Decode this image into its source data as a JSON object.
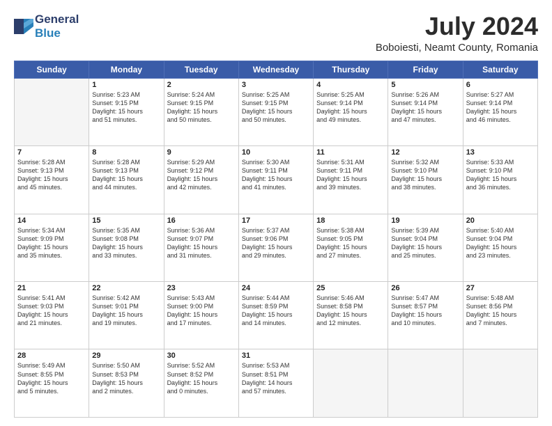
{
  "header": {
    "logo_general": "General",
    "logo_blue": "Blue",
    "month_year": "July 2024",
    "location": "Boboiesti, Neamt County, Romania"
  },
  "weekdays": [
    "Sunday",
    "Monday",
    "Tuesday",
    "Wednesday",
    "Thursday",
    "Friday",
    "Saturday"
  ],
  "weeks": [
    [
      {
        "day": "",
        "text": ""
      },
      {
        "day": "1",
        "text": "Sunrise: 5:23 AM\nSunset: 9:15 PM\nDaylight: 15 hours\nand 51 minutes."
      },
      {
        "day": "2",
        "text": "Sunrise: 5:24 AM\nSunset: 9:15 PM\nDaylight: 15 hours\nand 50 minutes."
      },
      {
        "day": "3",
        "text": "Sunrise: 5:25 AM\nSunset: 9:15 PM\nDaylight: 15 hours\nand 50 minutes."
      },
      {
        "day": "4",
        "text": "Sunrise: 5:25 AM\nSunset: 9:14 PM\nDaylight: 15 hours\nand 49 minutes."
      },
      {
        "day": "5",
        "text": "Sunrise: 5:26 AM\nSunset: 9:14 PM\nDaylight: 15 hours\nand 47 minutes."
      },
      {
        "day": "6",
        "text": "Sunrise: 5:27 AM\nSunset: 9:14 PM\nDaylight: 15 hours\nand 46 minutes."
      }
    ],
    [
      {
        "day": "7",
        "text": "Sunrise: 5:28 AM\nSunset: 9:13 PM\nDaylight: 15 hours\nand 45 minutes."
      },
      {
        "day": "8",
        "text": "Sunrise: 5:28 AM\nSunset: 9:13 PM\nDaylight: 15 hours\nand 44 minutes."
      },
      {
        "day": "9",
        "text": "Sunrise: 5:29 AM\nSunset: 9:12 PM\nDaylight: 15 hours\nand 42 minutes."
      },
      {
        "day": "10",
        "text": "Sunrise: 5:30 AM\nSunset: 9:11 PM\nDaylight: 15 hours\nand 41 minutes."
      },
      {
        "day": "11",
        "text": "Sunrise: 5:31 AM\nSunset: 9:11 PM\nDaylight: 15 hours\nand 39 minutes."
      },
      {
        "day": "12",
        "text": "Sunrise: 5:32 AM\nSunset: 9:10 PM\nDaylight: 15 hours\nand 38 minutes."
      },
      {
        "day": "13",
        "text": "Sunrise: 5:33 AM\nSunset: 9:10 PM\nDaylight: 15 hours\nand 36 minutes."
      }
    ],
    [
      {
        "day": "14",
        "text": "Sunrise: 5:34 AM\nSunset: 9:09 PM\nDaylight: 15 hours\nand 35 minutes."
      },
      {
        "day": "15",
        "text": "Sunrise: 5:35 AM\nSunset: 9:08 PM\nDaylight: 15 hours\nand 33 minutes."
      },
      {
        "day": "16",
        "text": "Sunrise: 5:36 AM\nSunset: 9:07 PM\nDaylight: 15 hours\nand 31 minutes."
      },
      {
        "day": "17",
        "text": "Sunrise: 5:37 AM\nSunset: 9:06 PM\nDaylight: 15 hours\nand 29 minutes."
      },
      {
        "day": "18",
        "text": "Sunrise: 5:38 AM\nSunset: 9:05 PM\nDaylight: 15 hours\nand 27 minutes."
      },
      {
        "day": "19",
        "text": "Sunrise: 5:39 AM\nSunset: 9:04 PM\nDaylight: 15 hours\nand 25 minutes."
      },
      {
        "day": "20",
        "text": "Sunrise: 5:40 AM\nSunset: 9:04 PM\nDaylight: 15 hours\nand 23 minutes."
      }
    ],
    [
      {
        "day": "21",
        "text": "Sunrise: 5:41 AM\nSunset: 9:03 PM\nDaylight: 15 hours\nand 21 minutes."
      },
      {
        "day": "22",
        "text": "Sunrise: 5:42 AM\nSunset: 9:01 PM\nDaylight: 15 hours\nand 19 minutes."
      },
      {
        "day": "23",
        "text": "Sunrise: 5:43 AM\nSunset: 9:00 PM\nDaylight: 15 hours\nand 17 minutes."
      },
      {
        "day": "24",
        "text": "Sunrise: 5:44 AM\nSunset: 8:59 PM\nDaylight: 15 hours\nand 14 minutes."
      },
      {
        "day": "25",
        "text": "Sunrise: 5:46 AM\nSunset: 8:58 PM\nDaylight: 15 hours\nand 12 minutes."
      },
      {
        "day": "26",
        "text": "Sunrise: 5:47 AM\nSunset: 8:57 PM\nDaylight: 15 hours\nand 10 minutes."
      },
      {
        "day": "27",
        "text": "Sunrise: 5:48 AM\nSunset: 8:56 PM\nDaylight: 15 hours\nand 7 minutes."
      }
    ],
    [
      {
        "day": "28",
        "text": "Sunrise: 5:49 AM\nSunset: 8:55 PM\nDaylight: 15 hours\nand 5 minutes."
      },
      {
        "day": "29",
        "text": "Sunrise: 5:50 AM\nSunset: 8:53 PM\nDaylight: 15 hours\nand 2 minutes."
      },
      {
        "day": "30",
        "text": "Sunrise: 5:52 AM\nSunset: 8:52 PM\nDaylight: 15 hours\nand 0 minutes."
      },
      {
        "day": "31",
        "text": "Sunrise: 5:53 AM\nSunset: 8:51 PM\nDaylight: 14 hours\nand 57 minutes."
      },
      {
        "day": "",
        "text": ""
      },
      {
        "day": "",
        "text": ""
      },
      {
        "day": "",
        "text": ""
      }
    ]
  ]
}
